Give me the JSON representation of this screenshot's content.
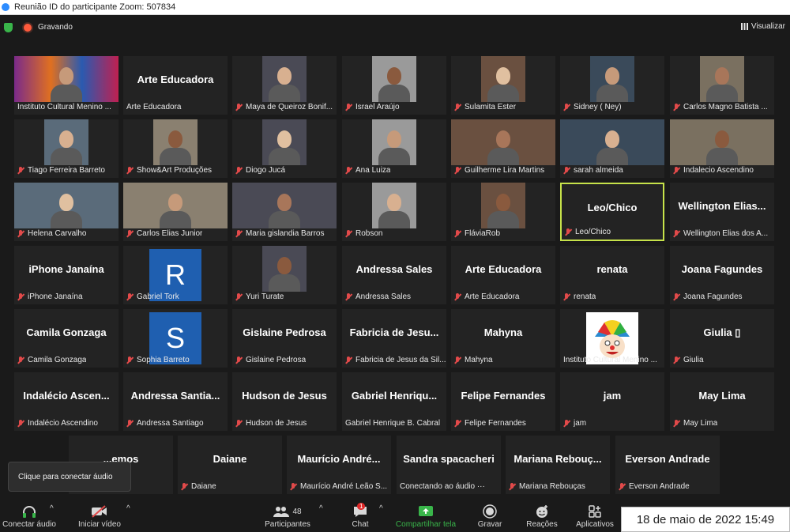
{
  "window": {
    "title": "Reunião ID do participante Zoom: 507834"
  },
  "topbar": {
    "recording_label": "Gravando",
    "view_label": "Visualizar"
  },
  "participants": [
    {
      "name": "Instituto Cultural Menino ...",
      "muted": false,
      "photo": "wide-colorful"
    },
    {
      "name": "Arte Educadora",
      "big": "Arte Educadora",
      "muted": false
    },
    {
      "name": "Maya de Queiroz Bonif...",
      "muted": true,
      "photo": "face"
    },
    {
      "name": "Israel Araújo",
      "muted": true,
      "photo": "face"
    },
    {
      "name": "Sulamita Ester",
      "muted": true,
      "photo": "face"
    },
    {
      "name": "Sidney ( Ney)",
      "muted": true,
      "photo": "face"
    },
    {
      "name": "Carlos Magno Batista ...",
      "muted": true,
      "photo": "face"
    },
    {
      "name": "Tiago Ferreira Barreto",
      "muted": true,
      "photo": "face"
    },
    {
      "name": "Show&Art Produções",
      "muted": true,
      "photo": "face"
    },
    {
      "name": "Diogo Jucá",
      "muted": true,
      "photo": "face"
    },
    {
      "name": "Ana Luiza",
      "muted": true,
      "photo": "face"
    },
    {
      "name": "Guilherme Lira Martins",
      "muted": true,
      "photo": "wide"
    },
    {
      "name": "sarah almeida",
      "muted": true,
      "photo": "wide"
    },
    {
      "name": "Indalecio Ascendino",
      "muted": true,
      "photo": "wide"
    },
    {
      "name": "Helena Carvalho",
      "muted": true,
      "photo": "wide"
    },
    {
      "name": "Carlos Elias Junior",
      "muted": true,
      "photo": "wide"
    },
    {
      "name": "Maria gislandia Barros",
      "muted": true,
      "photo": "wide"
    },
    {
      "name": "Robson",
      "muted": true,
      "photo": "face"
    },
    {
      "name": "FláviaRob",
      "muted": true,
      "photo": "face"
    },
    {
      "name": "Leo/Chico",
      "big": "Leo/Chico",
      "muted": true,
      "selected": true
    },
    {
      "name": "Wellington Elias dos A...",
      "big": "Wellington  Elias...",
      "muted": true
    },
    {
      "name": "iPhone Janaína",
      "big": "iPhone Janaína",
      "muted": true
    },
    {
      "name": "Gabriel Tork",
      "muted": true,
      "avatar": "R"
    },
    {
      "name": "Yuri Turate",
      "muted": true,
      "photo": "face"
    },
    {
      "name": "Andressa Sales",
      "big": "Andressa Sales",
      "muted": true
    },
    {
      "name": "Arte Educadora",
      "big": "Arte Educadora",
      "muted": true
    },
    {
      "name": "renata",
      "big": "renata",
      "muted": true
    },
    {
      "name": "Joana Fagundes",
      "big": "Joana Fagundes",
      "muted": true
    },
    {
      "name": "Camila Gonzaga",
      "big": "Camila Gonzaga",
      "muted": true
    },
    {
      "name": "Sophia Barreto",
      "muted": true,
      "avatar": "S"
    },
    {
      "name": "Gislaine Pedrosa",
      "big": "Gislaine Pedrosa",
      "muted": true
    },
    {
      "name": "Fabricia de Jesus da Sil...",
      "big": "Fabricia  de  Jesu...",
      "muted": true
    },
    {
      "name": "Mahyna",
      "big": "Mahyna",
      "muted": true
    },
    {
      "name": "Instituto Cultural Menino ...",
      "muted": false,
      "avatar": "clown"
    },
    {
      "name": "Giulia",
      "big": "Giulia ▯",
      "muted": true
    },
    {
      "name": "Indalécio Ascendino",
      "big": "Indalécio  Ascen...",
      "muted": true
    },
    {
      "name": "Andressa Santiago",
      "big": "Andressa  Santia...",
      "muted": true
    },
    {
      "name": "Hudson de Jesus",
      "big": "Hudson de Jesus",
      "muted": true
    },
    {
      "name": "Gabriel Henrique B. Cabral",
      "big": "Gabriel  Henriqu...",
      "muted": false
    },
    {
      "name": "Felipe Fernandes",
      "big": "Felipe Fernandes",
      "muted": true
    },
    {
      "name": "jam",
      "big": "jam",
      "muted": true
    },
    {
      "name": "May Lima",
      "big": "May Lima",
      "muted": true
    },
    {
      "name": "",
      "big": "...emos",
      "muted": false
    },
    {
      "name": "Daiane",
      "big": "Daiane",
      "muted": true
    },
    {
      "name": "Maurício André Leão S...",
      "big": "Maurício  André...",
      "muted": true
    },
    {
      "name": "Conectando ao áudio ···",
      "big": "Sandra spacacheri",
      "muted": false
    },
    {
      "name": "Mariana Rebouças",
      "big": "Mariana  Rebouç...",
      "muted": true
    },
    {
      "name": "Everson Andrade",
      "big": "Everson Andrade",
      "muted": true
    }
  ],
  "tooltip": {
    "text": "Clique para conectar áudio"
  },
  "toolbar": {
    "audio_label": "Conectar áudio",
    "video_label": "Iniciar vídeo",
    "participants_label": "Participantes",
    "participants_count": "48",
    "chat_label": "Chat",
    "chat_badge": "1",
    "share_label": "Compartilhar tela",
    "record_label": "Gravar",
    "reactions_label": "Reações",
    "apps_label": "Aplicativos"
  },
  "timestamp": "18 de maio de 2022 15:49",
  "colors": {
    "accent_green": "#39b54a",
    "mute_red": "#e24a4a",
    "active_border": "#c6e24a",
    "avatar_blue": "#1f5fb0"
  }
}
